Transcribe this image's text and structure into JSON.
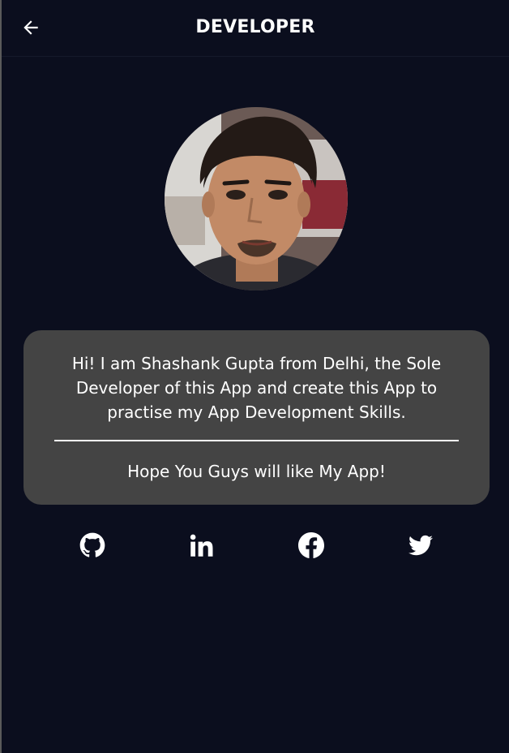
{
  "appbar": {
    "back_icon": "arrow-left-icon",
    "title": "DEVELOPER"
  },
  "profile": {
    "avatar_icon": "developer-photo"
  },
  "card": {
    "intro": "Hi! I am Shashank Gupta from Delhi, the Sole Developer of this App and create this App to practise my App Development Skills.",
    "closing": "Hope You Guys will like My App!"
  },
  "socials": [
    {
      "icon": "github-icon"
    },
    {
      "icon": "linkedin-icon"
    },
    {
      "icon": "facebook-icon"
    },
    {
      "icon": "twitter-icon"
    }
  ],
  "colors": {
    "background": "#0b0e1e",
    "card": "#444444",
    "text": "#ffffff"
  }
}
